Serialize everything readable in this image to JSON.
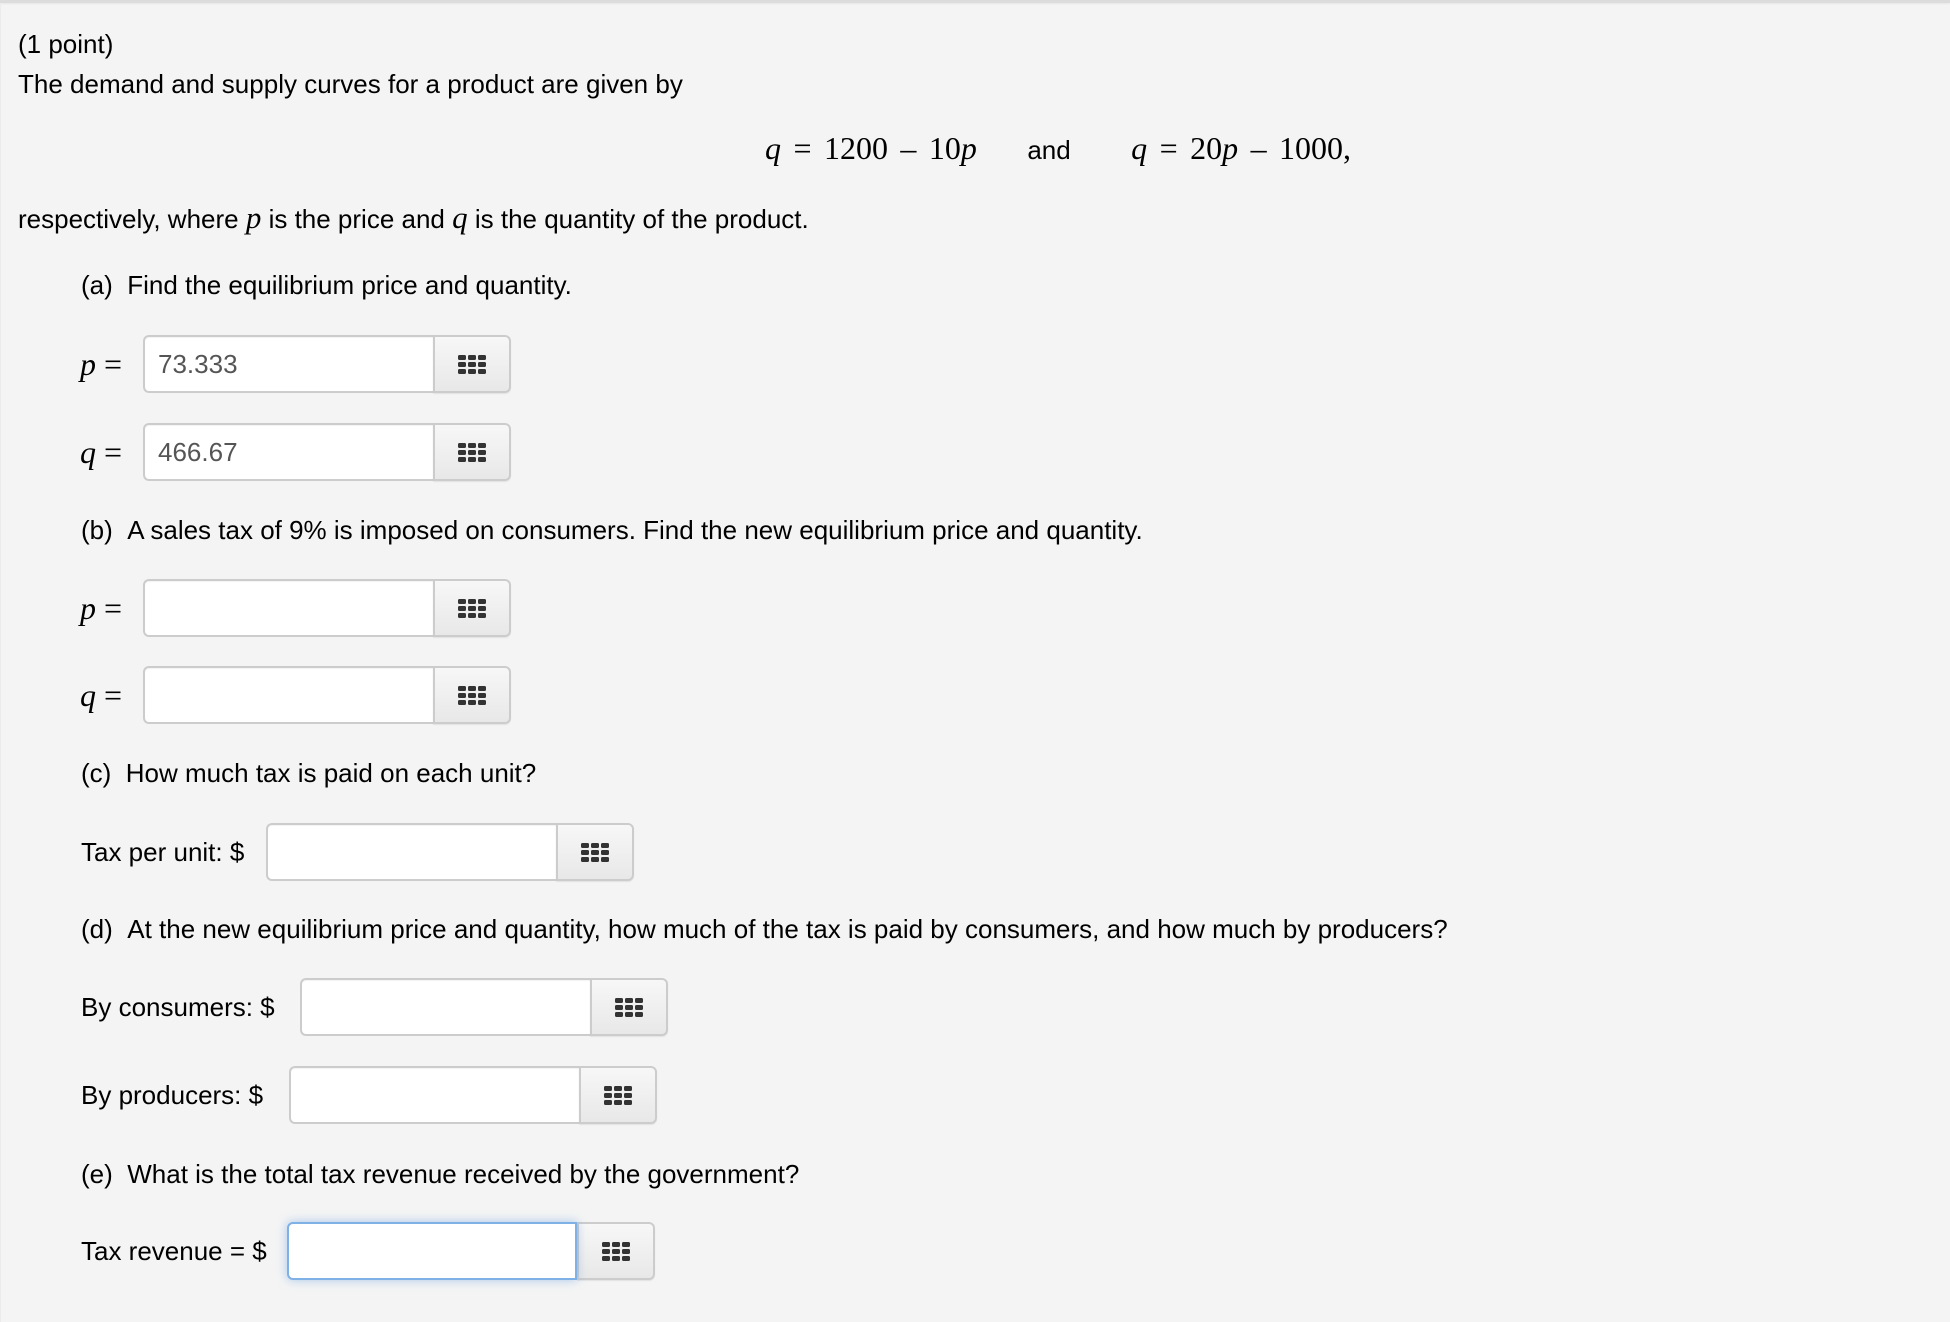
{
  "header": {
    "points": "(1 point)",
    "intro": "The demand and supply curves for a product are given by"
  },
  "equations": {
    "demand": {
      "lhs": "q",
      "eq": "=",
      "const": "1200",
      "op": "–",
      "coef": "10",
      "var": "p"
    },
    "connector": "and",
    "supply": {
      "lhs": "q",
      "eq": "=",
      "coef": "20",
      "var": "p",
      "op": "–",
      "const": "1000",
      "trail": ","
    }
  },
  "definition": {
    "part1": "respectively, where ",
    "var1": "p",
    "part2": " is the price and ",
    "var2": "q",
    "part3": " is the quantity of the product."
  },
  "parts": {
    "a": {
      "label": "(a)",
      "question": "Find the equilibrium price and quantity.",
      "p_label": {
        "var": "p",
        "eq": "="
      },
      "q_label": {
        "var": "q",
        "eq": "="
      },
      "p_value": "73.333",
      "q_value": "466.67"
    },
    "b": {
      "label": "(b)",
      "question": "A sales tax of 9% is imposed on consumers. Find the new equilibrium price and quantity.",
      "p_label": {
        "var": "p",
        "eq": "="
      },
      "q_label": {
        "var": "q",
        "eq": "="
      },
      "p_value": "",
      "q_value": ""
    },
    "c": {
      "label": "(c)",
      "question": "How much tax is paid on each unit?",
      "field_label": "Tax per unit: $",
      "value": ""
    },
    "d": {
      "label": "(d)",
      "question": "At the new equilibrium price and quantity, how much of the tax is paid by consumers, and how much by producers?",
      "consumers_label": "By consumers: $",
      "producers_label": "By producers: $",
      "consumers_value": "",
      "producers_value": ""
    },
    "e": {
      "label": "(e)",
      "question": "What is the total tax revenue received by the government?",
      "field_label": "Tax revenue = $",
      "value": "",
      "focused": true
    }
  },
  "icons": {
    "equation_editor": "grid-icon"
  },
  "colors": {
    "background": "#f4f4f4",
    "input_border": "#cccccc",
    "focus_border": "#7fb1e6",
    "value_text": "#555555"
  }
}
